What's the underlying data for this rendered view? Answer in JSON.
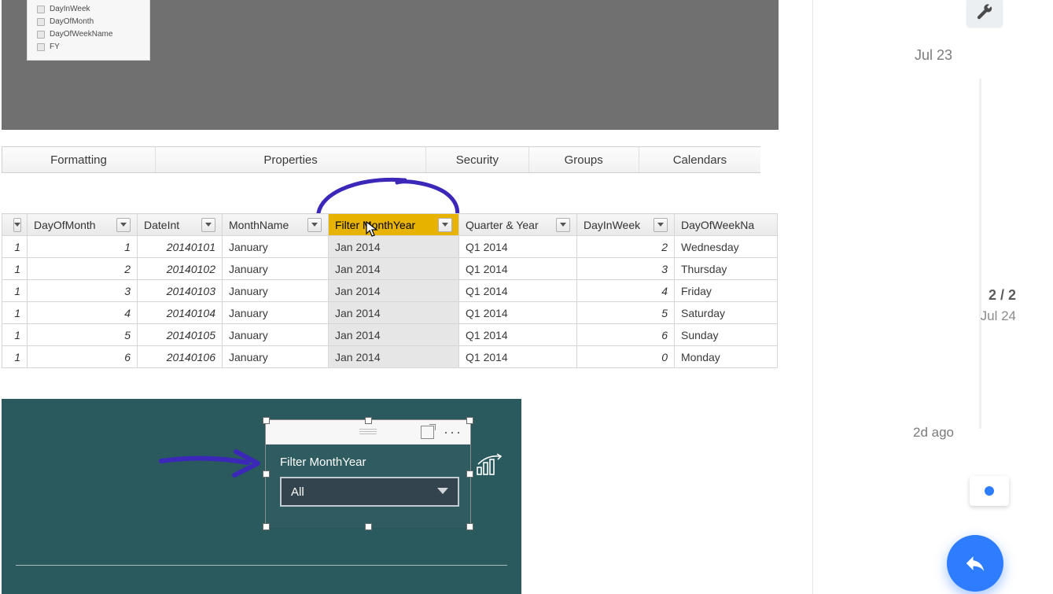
{
  "colors": {
    "accent": "#2e7cff",
    "highlight": "#e8b200",
    "teal": "#2a5a5e",
    "ink": "#3b27b8"
  },
  "fields_panel": {
    "items": [
      "DayInWeek",
      "DayOfMonth",
      "DayOfWeekName",
      "FY"
    ]
  },
  "ribbon": {
    "tabs": [
      "Formatting",
      "Properties",
      "Security",
      "Groups",
      "Calendars"
    ]
  },
  "table": {
    "row_numbers": [
      "1",
      "1",
      "1",
      "1",
      "1",
      "1"
    ],
    "columns": [
      {
        "key": "DayOfMonth",
        "label": "DayOfMonth",
        "type": "int"
      },
      {
        "key": "DateInt",
        "label": "DateInt",
        "type": "int"
      },
      {
        "key": "MonthName",
        "label": "MonthName",
        "type": "text"
      },
      {
        "key": "FilterMonthYear",
        "label": "Filter MonthYear",
        "type": "text",
        "highlighted": true
      },
      {
        "key": "QuarterYear",
        "label": "Quarter & Year",
        "type": "text"
      },
      {
        "key": "DayInWeek",
        "label": "DayInWeek",
        "type": "int"
      },
      {
        "key": "DayOfWeekName",
        "label": "DayOfWeekNa",
        "type": "text"
      }
    ],
    "rows": [
      {
        "DayOfMonth": "1",
        "DateInt": "20140101",
        "MonthName": "January",
        "FilterMonthYear": "Jan 2014",
        "QuarterYear": "Q1 2014",
        "DayInWeek": "2",
        "DayOfWeekName": "Wednesday"
      },
      {
        "DayOfMonth": "2",
        "DateInt": "20140102",
        "MonthName": "January",
        "FilterMonthYear": "Jan 2014",
        "QuarterYear": "Q1 2014",
        "DayInWeek": "3",
        "DayOfWeekName": "Thursday"
      },
      {
        "DayOfMonth": "3",
        "DateInt": "20140103",
        "MonthName": "January",
        "FilterMonthYear": "Jan 2014",
        "QuarterYear": "Q1 2014",
        "DayInWeek": "4",
        "DayOfWeekName": "Friday"
      },
      {
        "DayOfMonth": "4",
        "DateInt": "20140104",
        "MonthName": "January",
        "FilterMonthYear": "Jan 2014",
        "QuarterYear": "Q1 2014",
        "DayInWeek": "5",
        "DayOfWeekName": "Saturday"
      },
      {
        "DayOfMonth": "5",
        "DateInt": "20140105",
        "MonthName": "January",
        "FilterMonthYear": "Jan 2014",
        "QuarterYear": "Q1 2014",
        "DayInWeek": "6",
        "DayOfWeekName": "Sunday"
      },
      {
        "DayOfMonth": "6",
        "DateInt": "20140106",
        "MonthName": "January",
        "FilterMonthYear": "Jan 2014",
        "QuarterYear": "Q1 2014",
        "DayInWeek": "0",
        "DayOfWeekName": "Monday"
      }
    ]
  },
  "slicer": {
    "title": "Filter MonthYear",
    "value": "All"
  },
  "sidebar": {
    "top_date": "Jul 23",
    "pager_counts": "2 / 2",
    "pager_date": "Jul 24",
    "bottom_date": "2d ago"
  }
}
